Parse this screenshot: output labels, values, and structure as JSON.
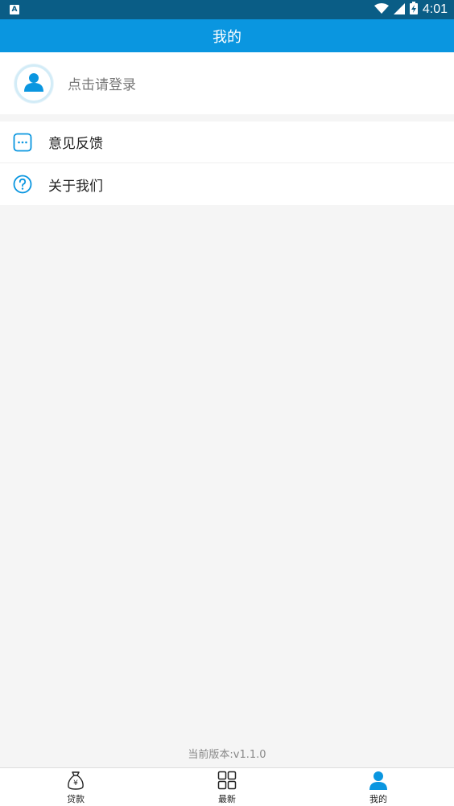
{
  "status_bar": {
    "indicator": "A",
    "time": "4:01",
    "icons": [
      "wifi-icon",
      "signal-icon",
      "battery-icon"
    ]
  },
  "header": {
    "title": "我的"
  },
  "profile": {
    "login_prompt": "点击请登录",
    "icon": "user-icon"
  },
  "menu": {
    "items": [
      {
        "label": "意见反馈",
        "icon": "feedback-icon"
      },
      {
        "label": "关于我们",
        "icon": "help-icon"
      }
    ]
  },
  "footer": {
    "version_text": "当前版本:v1.1.0"
  },
  "tab_bar": {
    "tabs": [
      {
        "label": "贷款",
        "icon": "money-bag-icon",
        "active": false
      },
      {
        "label": "最新",
        "icon": "grid-icon",
        "active": false
      },
      {
        "label": "我的",
        "icon": "user-icon",
        "active": true
      }
    ]
  },
  "colors": {
    "primary": "#0a96e0",
    "status_bar": "#0a5d86",
    "background": "#f5f5f5",
    "text_primary": "#222222",
    "text_secondary": "#777777"
  }
}
